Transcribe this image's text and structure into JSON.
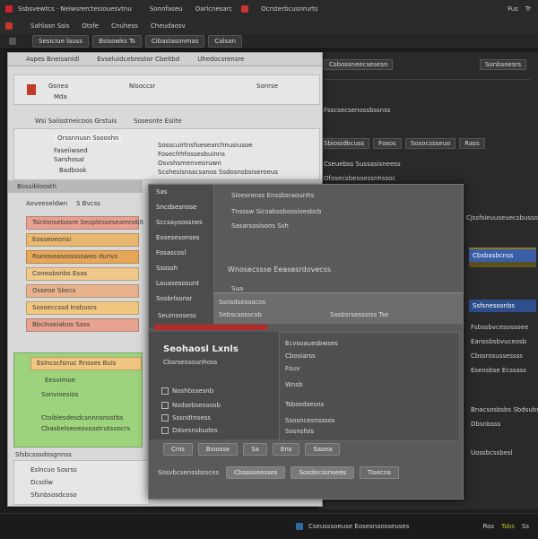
{
  "topbar": {
    "title": "Ssbsvewtcs · Neiwsrerctesiouesvtnu",
    "menu": [
      "Sonnfaseu",
      "Oarlcnesarc",
      "Ocrsterbcusnrurts"
    ],
    "right": [
      "Fus",
      "Tr"
    ]
  },
  "toolbar": {
    "items": [
      "Sahlasn Ssis",
      "Otsfe",
      "Cnuhess",
      "Cheudaosv"
    ]
  },
  "tabs": {
    "items": [
      "Sesiciue lauss",
      "Bsisowks Ts",
      "Cibaslasonmas",
      "Calsan"
    ]
  },
  "left_window": {
    "header": [
      "Aspes Bneisanidl",
      "Evseluidcebrestor Cbeitbd",
      "Uhedocsrensre"
    ],
    "row1": {
      "field1": "Gsnea",
      "field2": "Nisoccsr",
      "field3": "Sonrse",
      "sub": "Mda"
    },
    "section2_title": "Wsi Saiisstneicoos Grstuis",
    "section2_right": "Soseonte Esiite",
    "list2": [
      "Orssnnusn Ssooshn",
      "Sosscuirtnsfuesearchnusiusoe",
      "Fosecfrhfossesbuinns",
      "Osvshsmenveoruwn",
      "Scshesisnsscsanos Ssdosnsbsiseroeus"
    ],
    "left_list": [
      "Faseiiwsed",
      "Sarshosal",
      "Badbook"
    ],
    "section3_title": "Bossibloosth",
    "section3_sub": [
      "Aoveeseldwn",
      "S Bvcss"
    ],
    "stripes": [
      {
        "label": "Tsinlonsebosre Seuplesseseamroblt",
        "color": "#e8a090"
      },
      {
        "label": "Eosseoeonsi",
        "color": "#e9b870"
      },
      {
        "label": "Rseioseasosssssweo dunvs",
        "color": "#e6a858"
      },
      {
        "label": "Coneabsnbs Esas",
        "color": "#efc88a"
      },
      {
        "label": "Osseoe Sbecs",
        "color": "#e8b38c"
      },
      {
        "label": "Sosoeccssd Insbusrs",
        "color": "#f0c680"
      },
      {
        "label": "Bbclnseiabos Ssos",
        "color": "#e7a290"
      }
    ],
    "green": [
      "Eslncscfsnuc Rnsses Buls",
      "Eesvimoe",
      "Sonvioesios",
      "Ctsiblesdesdcsnnnsnsstbs",
      "Cbasbelseoesvsostrutsoocrs"
    ],
    "bottom_title": "Sfsbcsssdosgnnss",
    "bottom_list": [
      "Eslncuo Sosrss",
      "Dcsdiw",
      "Sfsnbsosdcoso"
    ]
  },
  "dialog": {
    "menu": [
      "Sas",
      "Sncdsesnose",
      "Sccsaysossnes",
      "Eosesesonses",
      "Fosascosl",
      "Ssossh",
      "Lauasesosunt",
      "Sosbrlsonsr"
    ],
    "head": [
      "Sioesronss Enssbsraounhs",
      "Tnsssw Sicsabssbossioesbcb",
      "Sasarsosisons Ssh"
    ],
    "head2": "Wnosecssse Eeasesrdovecss",
    "field": "Sua",
    "sel_row": [
      "Ssnsdsesoscos",
      "Sebscsosscsb",
      "Sasbsrsessoiss Tse"
    ],
    "red_label": "Seuinsosess",
    "bold_title": "Seohaosl Lxnls",
    "bold_sub": "Cbsrsessounhoss",
    "checks": [
      "Noshbssesnb",
      "Nsdsebsesoosb",
      "Sssndtnsess",
      "Ddsesnsbudes"
    ],
    "right_list": [
      "Ecvsoauesbwses",
      "Cbosiarss",
      "Fsuv",
      "Wnsb",
      "Tsbsedsesns",
      "Ssosncesnsssos",
      "Sosnsfsls"
    ],
    "footer": [
      "Cnis",
      "Bsiosse",
      "Sa",
      "Ens",
      "Sasea"
    ],
    "footer2": [
      "Sosvbcsenssbssces",
      "Cbssoseosses",
      "Sosdecssnsees",
      "Tisecns"
    ]
  },
  "right_pane": {
    "head": [
      "Csbossneecsesesn",
      "Sonbsoesrs"
    ],
    "chips": [
      "Sbiosidbcuss",
      "Fosos",
      "Sosocssseuo",
      "Rass"
    ],
    "rows": [
      "Fsscsecsenossbssnss",
      "Cseuebss Sussasisneess",
      "Ofosecsbesoessnhssoc",
      "Cjssfsieuuseuecsbussos",
      "Fsbssbvcesossoee",
      "Eanssbsbvuceosb",
      "Cbssrosussessss",
      "Eseosbse Ecssass"
    ],
    "blue": [
      "Cbsbasbcnss",
      "Ssfsnessonbs"
    ],
    "bottom": [
      "Bnacsosbsbs Sbdsubsss",
      "Dbsnbsss",
      "Uossbcssbesl"
    ],
    "accent": "#3b5ea8"
  },
  "status": {
    "text": "Cseusssoeuse Eosesnaosseuses",
    "right": [
      "Ros",
      "Tsbs",
      "Ss"
    ]
  }
}
